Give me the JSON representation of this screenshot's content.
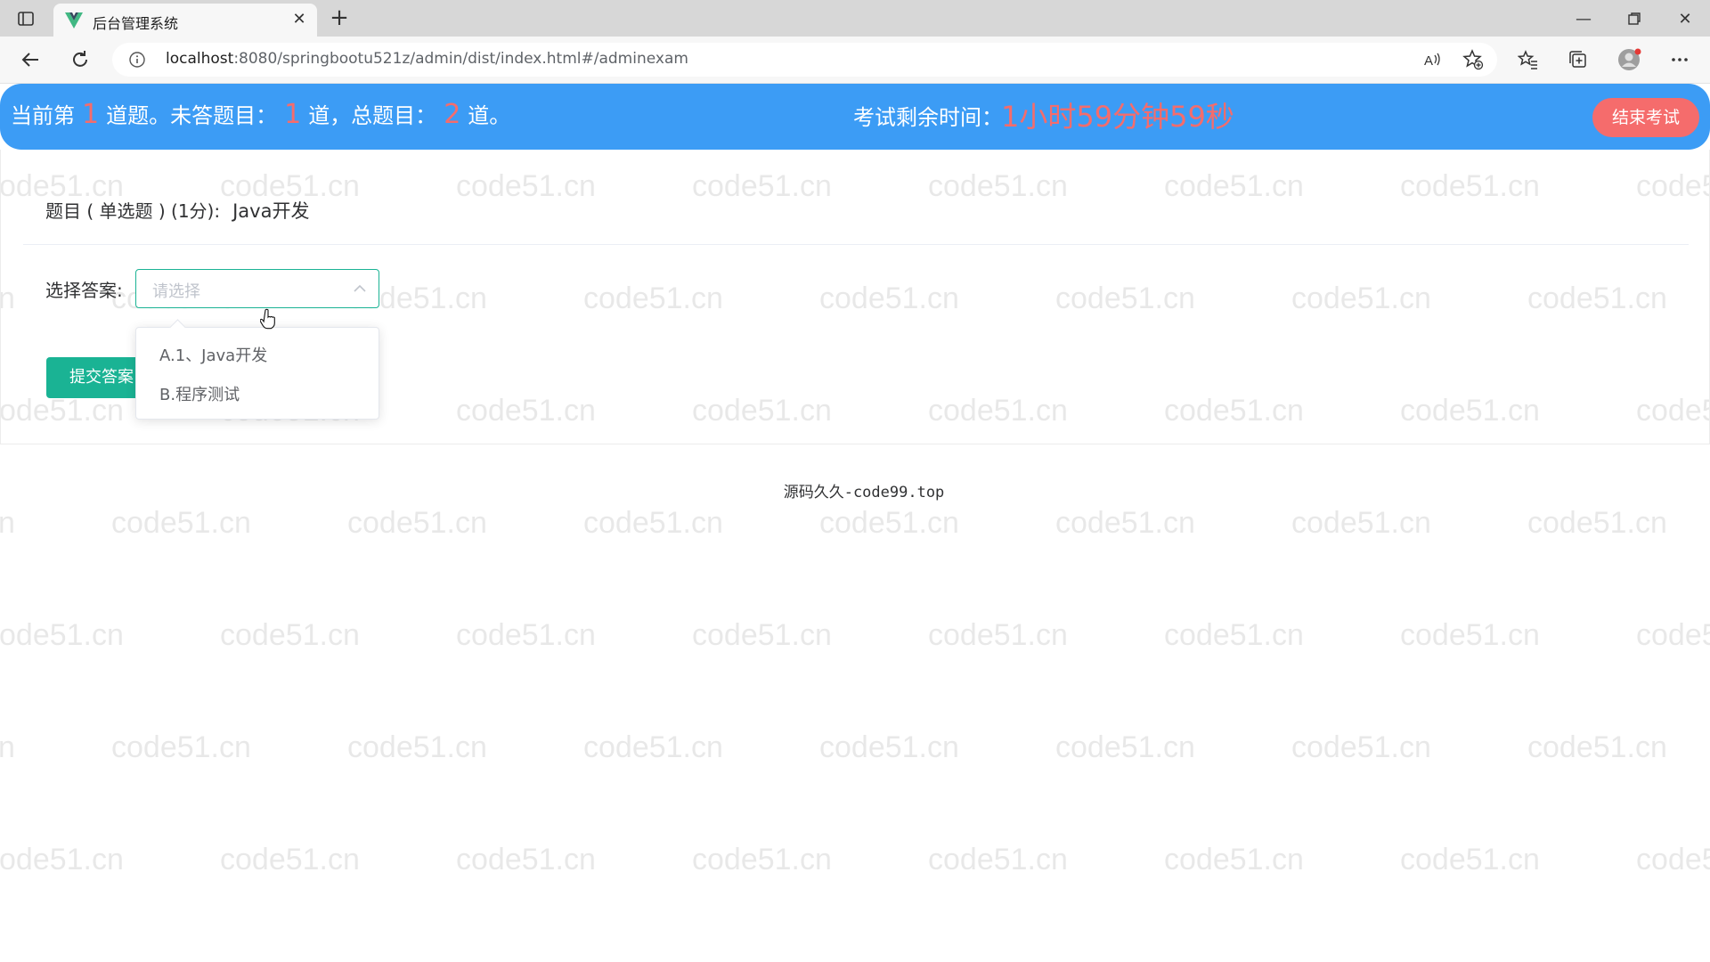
{
  "browser": {
    "tab_title": "后台管理系统",
    "url_host": "localhost",
    "url_path": ":8080/springbootu521z/admin/dist/index.html#/adminexam",
    "icons": [
      "sidebar-toggle-icon",
      "vue-favicon-icon",
      "close-icon",
      "plus-icon",
      "minimize-icon",
      "restore-icon",
      "window-close-icon",
      "back-arrow-icon",
      "reload-icon",
      "info-icon",
      "read-aloud-icon",
      "add-favorite-icon",
      "favorites-icon",
      "collections-icon",
      "profile-icon",
      "more-icon"
    ]
  },
  "exam": {
    "current_prefix": "当前第",
    "current_num": "1",
    "current_suffix": "道题。未答题目：",
    "unanswered_num": "1",
    "unanswered_suffix": "道，总题目：",
    "total_num": "2",
    "total_suffix": "道。",
    "time_label": "考试剩余时间：",
    "time_value": "1小时59分钟59秒",
    "end_button": "结束考试"
  },
  "question": {
    "title_label": "题目 ( 单选题 ) (1分):",
    "title_text": "Java开发",
    "answer_label": "选择答案:",
    "select_placeholder": "请选择",
    "options": [
      "A.1、Java开发",
      "B.程序测试"
    ],
    "submit_button": "提交答案"
  },
  "footer": {
    "text": "源码久久-code99.top"
  },
  "watermark": {
    "text": "code51.cn"
  },
  "colors": {
    "header_bg": "#3c9cf5",
    "accent_red": "#f56c6c",
    "primary_green": "#1ab394"
  }
}
